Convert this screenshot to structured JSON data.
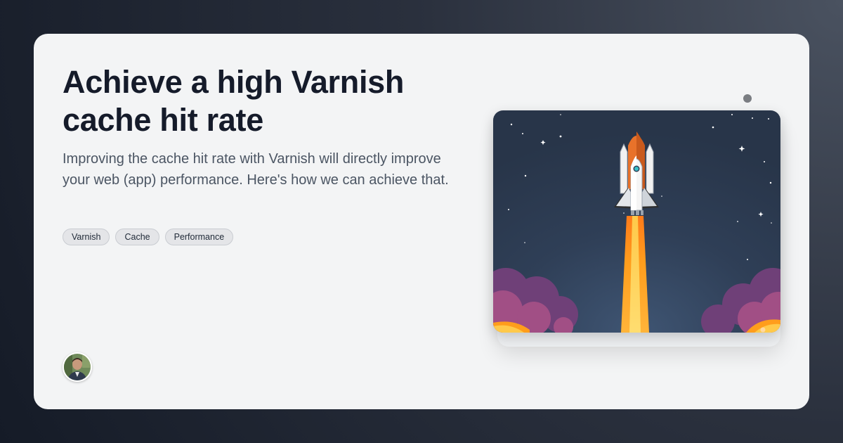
{
  "post": {
    "title": "Achieve a high Varnish cache hit rate",
    "description": "Improving the cache hit rate with Varnish will directly improve your web (app) performance. Here's how we can achieve that.",
    "tags": [
      "Varnish",
      "Cache",
      "Performance"
    ]
  },
  "hero": {
    "icon": "rocket-launch-illustration"
  },
  "author": {
    "icon": "avatar-photo"
  },
  "colors": {
    "card_bg": "#f3f4f5",
    "title": "#151b2a",
    "text": "#4b5563",
    "sky": "#2c3a4f",
    "flame": "#ff9d1c",
    "cloud": "#8a4e86"
  }
}
